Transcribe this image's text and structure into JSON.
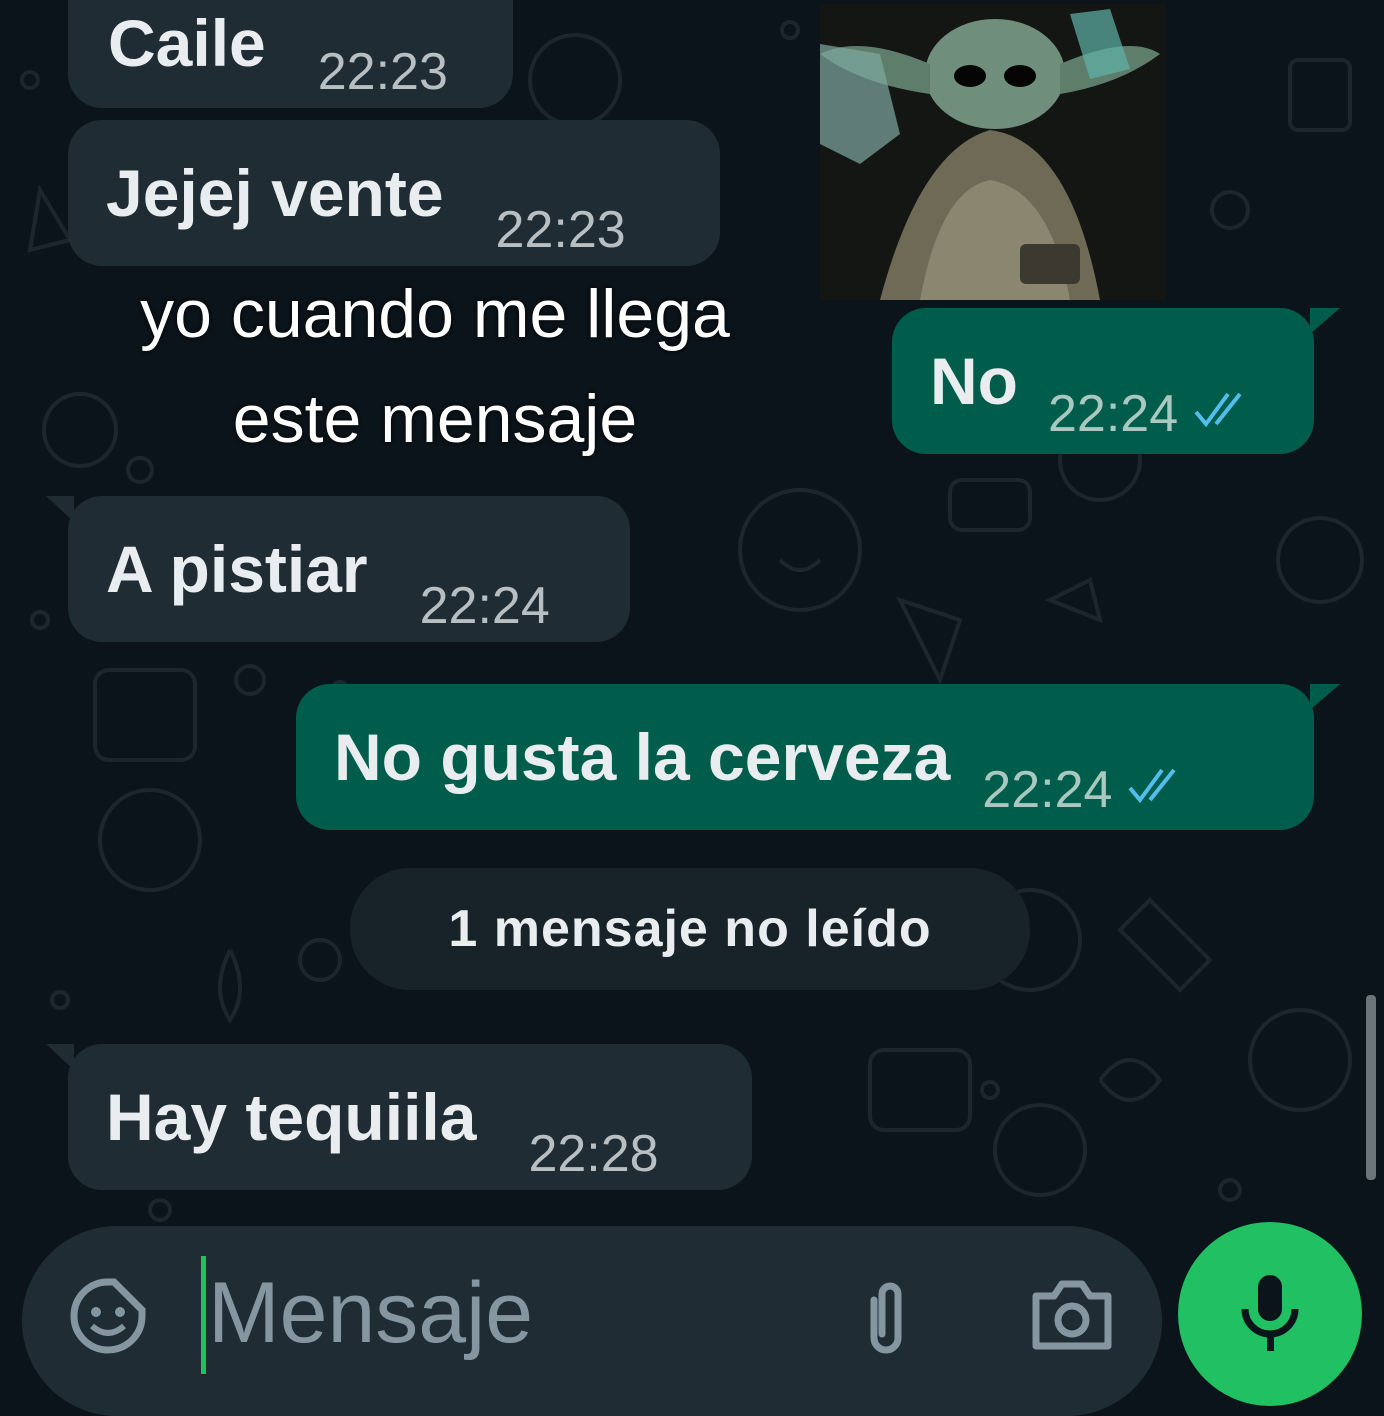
{
  "colors": {
    "background": "#0b141a",
    "incoming_bubble": "#1f2c33",
    "outgoing_bubble": "#005c4b",
    "accent": "#21c063",
    "read_ticks": "#53bdeb"
  },
  "messages": [
    {
      "direction": "incoming",
      "text": "Caile",
      "time": "22:23"
    },
    {
      "direction": "incoming",
      "text": "Jejej vente",
      "time": "22:23"
    },
    {
      "direction": "incoming",
      "type": "sticker",
      "caption": [
        "yo cuando me llega",
        "este mensaje"
      ]
    },
    {
      "direction": "outgoing",
      "text": "No",
      "time": "22:24",
      "status": "read"
    },
    {
      "direction": "incoming",
      "text": "A pistiar",
      "time": "22:24"
    },
    {
      "direction": "outgoing",
      "text": "No gusta la cerveza",
      "time": "22:24",
      "status": "read"
    },
    {
      "direction": "incoming",
      "text": "Hay tequiila",
      "time": "22:28"
    }
  ],
  "unread_divider": "1 mensaje no leído",
  "composer": {
    "placeholder": "Mensaje",
    "emoji_icon": "sticker-smiley-icon",
    "attach_icon": "paperclip-icon",
    "camera_icon": "camera-icon",
    "mic_icon": "microphone-icon"
  }
}
